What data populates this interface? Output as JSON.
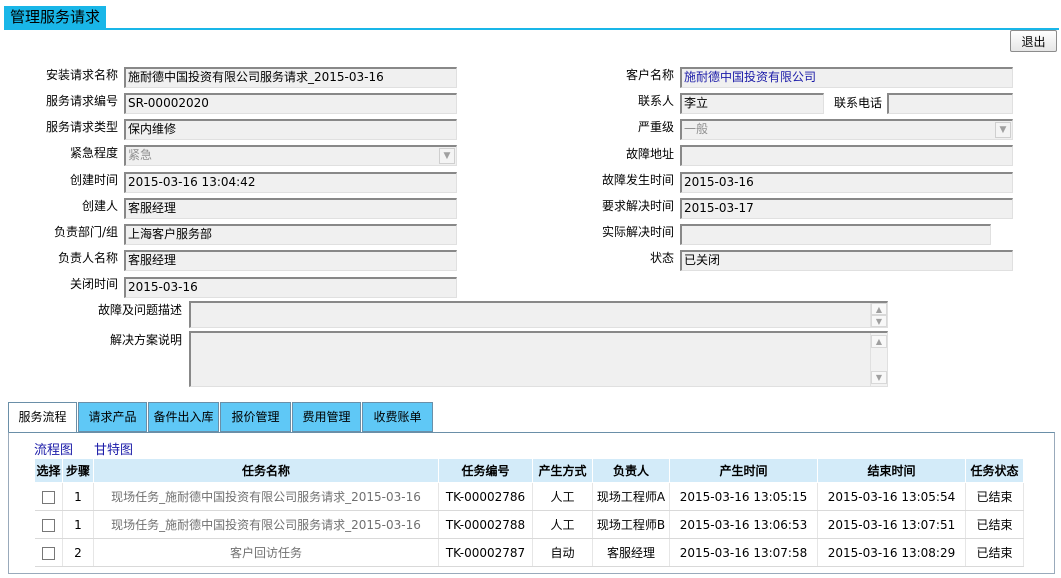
{
  "page": {
    "title": "管理服务请求",
    "exit_label": "退出"
  },
  "form": {
    "left": [
      {
        "label": "安装请求名称",
        "value": "施耐德中国投资有限公司服务请求_2015-03-16"
      },
      {
        "label": "服务请求编号",
        "value": "SR-00002020"
      },
      {
        "label": "服务请求类型",
        "value": "保内维修"
      },
      {
        "label": "紧急程度",
        "value": "紧急"
      },
      {
        "label": "创建时间",
        "value": "2015-03-16 13:04:42"
      },
      {
        "label": "创建人",
        "value": "客服经理"
      },
      {
        "label": "负责部门/组",
        "value": "上海客户服务部"
      },
      {
        "label": "负责人名称",
        "value": "客服经理"
      },
      {
        "label": "关闭时间",
        "value": "2015-03-16"
      }
    ],
    "right": {
      "customer": {
        "label": "客户名称",
        "value": "施耐德中国投资有限公司"
      },
      "contact": {
        "label": "联系人",
        "value": "李立"
      },
      "phone": {
        "label": "联系电话",
        "value": ""
      },
      "severity": {
        "label": "严重级",
        "value": "一般"
      },
      "address": {
        "label": "故障地址",
        "value": ""
      },
      "fault_time": {
        "label": "故障发生时间",
        "value": "2015-03-16"
      },
      "required_time": {
        "label": "要求解决时间",
        "value": "2015-03-17"
      },
      "actual_time": {
        "label": "实际解决时间",
        "value": ""
      },
      "status": {
        "label": "状态",
        "value": "已关闭"
      }
    },
    "fault_desc": {
      "label": "故障及问题描述",
      "value": ""
    },
    "solution": {
      "label": "解决方案说明",
      "value": ""
    }
  },
  "tabs": [
    "服务流程",
    "请求产品",
    "备件出入库",
    "报价管理",
    "费用管理",
    "收费账单"
  ],
  "sublinks": [
    "流程图",
    "甘特图"
  ],
  "table": {
    "headers": [
      "选择",
      "步骤",
      "任务名称",
      "任务编号",
      "产生方式",
      "负责人",
      "产生时间",
      "结束时间",
      "任务状态"
    ],
    "rows": [
      [
        "",
        "1",
        "现场任务_施耐德中国投资有限公司服务请求_2015-03-16",
        "TK-00002786",
        "人工",
        "现场工程师A",
        "2015-03-16 13:05:15",
        "2015-03-16 13:05:54",
        "已结束"
      ],
      [
        "",
        "1",
        "现场任务_施耐德中国投资有限公司服务请求_2015-03-16",
        "TK-00002788",
        "人工",
        "现场工程师B",
        "2015-03-16 13:06:53",
        "2015-03-16 13:07:51",
        "已结束"
      ],
      [
        "",
        "2",
        "客户回访任务",
        "TK-00002787",
        "自动",
        "客服经理",
        "2015-03-16 13:07:58",
        "2015-03-16 13:08:29",
        "已结束"
      ]
    ]
  }
}
